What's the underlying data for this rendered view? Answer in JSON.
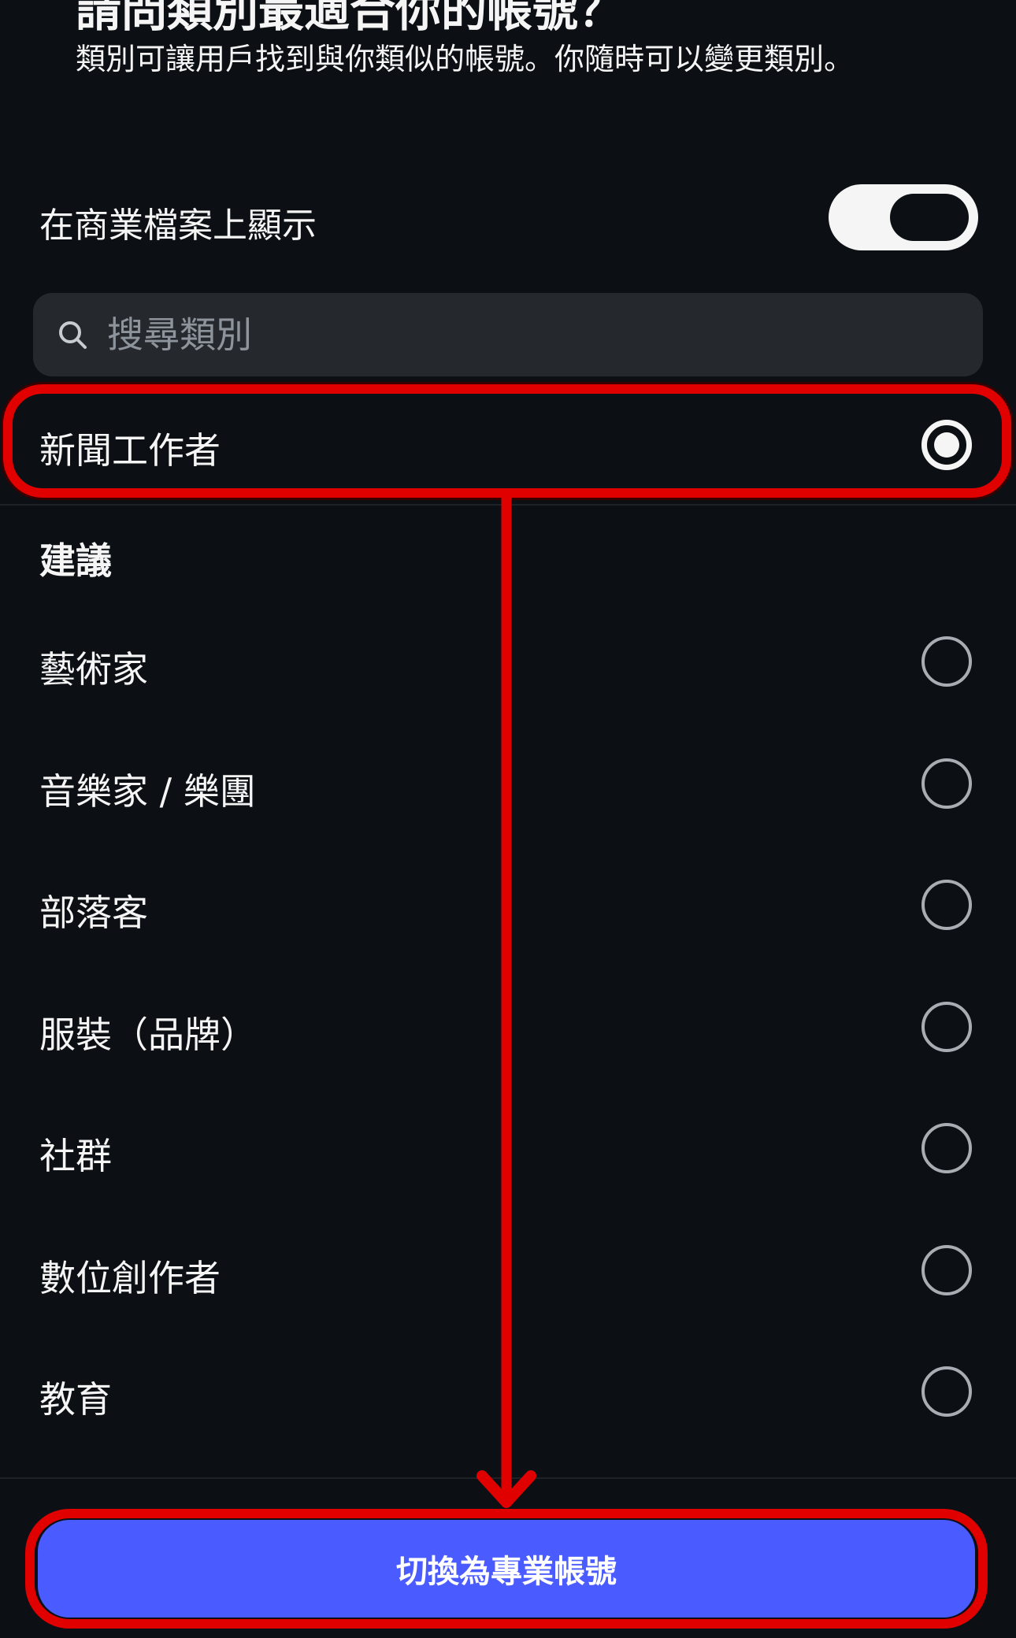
{
  "header": {
    "title_partial": "請問類別最適合你的帳號？",
    "subtitle": "類別可讓用戶找到與你類似的帳號。你隨時可以變更類別。"
  },
  "display_toggle": {
    "label": "在商業檔案上顯示",
    "on": true
  },
  "search": {
    "placeholder": "搜尋類別",
    "value": ""
  },
  "selected_category": {
    "label": "新聞工作者",
    "selected": true
  },
  "suggestions": {
    "header": "建議",
    "items": [
      {
        "label": "藝術家",
        "selected": false
      },
      {
        "label": "音樂家 / 樂團",
        "selected": false
      },
      {
        "label": "部落客",
        "selected": false
      },
      {
        "label": "服裝（品牌）",
        "selected": false
      },
      {
        "label": "社群",
        "selected": false
      },
      {
        "label": "數位創作者",
        "selected": false
      },
      {
        "label": "教育",
        "selected": false
      }
    ]
  },
  "cta": {
    "label": "切換為專業帳號"
  },
  "colors": {
    "background": "#0c1014",
    "accent": "#4a5cff",
    "annotation": "#e00000",
    "search_bg": "#25292e"
  }
}
